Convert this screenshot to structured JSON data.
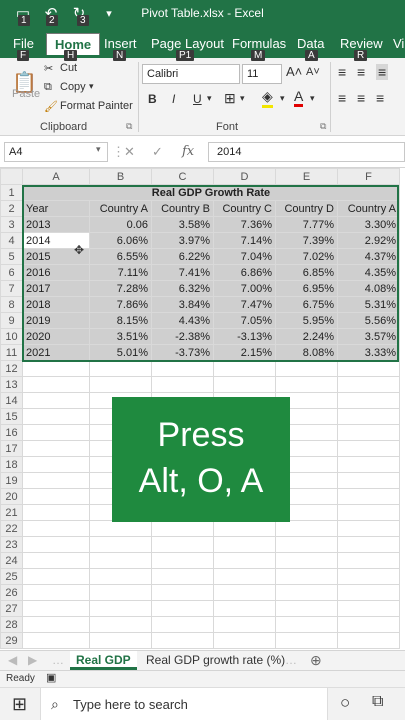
{
  "title_bar": {
    "title": "Pivot Table.xlsx - Excel",
    "keytips": [
      "1",
      "2",
      "3"
    ]
  },
  "ribbon_tabs": [
    {
      "label": "File",
      "keytip": "F"
    },
    {
      "label": "Home",
      "keytip": "H"
    },
    {
      "label": "Insert",
      "keytip": "N"
    },
    {
      "label": "Page Layout",
      "keytip": "P1"
    },
    {
      "label": "Formulas",
      "keytip": "M"
    },
    {
      "label": "Data",
      "keytip": "A"
    },
    {
      "label": "Review",
      "keytip": "R"
    },
    {
      "label": "Vi",
      "keytip": ""
    }
  ],
  "clipboard": {
    "paste": "Paste",
    "cut": "Cut",
    "copy": "Copy",
    "format_painter": "Format Painter",
    "label": "Clipboard"
  },
  "font": {
    "name": "Calibri",
    "size": "11",
    "bold": "B",
    "italic": "I",
    "underline": "U",
    "label": "Font"
  },
  "formula_bar": {
    "name_box": "A4",
    "fx": "fx",
    "value": "2014"
  },
  "columns": [
    "A",
    "B",
    "C",
    "D",
    "E",
    "F"
  ],
  "sheet": {
    "title": "Real GDP Growth Rate",
    "headers": [
      "Year",
      "Country A",
      "Country B",
      "Country C",
      "Country D",
      "Country A"
    ],
    "rows": [
      [
        "2013",
        "0.06",
        "3.58%",
        "7.36%",
        "7.77%",
        "3.30%"
      ],
      [
        "2014",
        "6.06%",
        "3.97%",
        "7.14%",
        "7.39%",
        "2.92%"
      ],
      [
        "2015",
        "6.55%",
        "6.22%",
        "7.04%",
        "7.02%",
        "4.37%"
      ],
      [
        "2016",
        "7.11%",
        "7.41%",
        "6.86%",
        "6.85%",
        "4.35%"
      ],
      [
        "2017",
        "7.28%",
        "6.32%",
        "7.00%",
        "6.95%",
        "4.08%"
      ],
      [
        "2018",
        "7.86%",
        "3.84%",
        "7.47%",
        "6.75%",
        "5.31%"
      ],
      [
        "2019",
        "8.15%",
        "4.43%",
        "7.05%",
        "5.95%",
        "5.56%"
      ],
      [
        "2020",
        "3.51%",
        "-2.38%",
        "-3.13%",
        "2.24%",
        "3.57%"
      ],
      [
        "2021",
        "5.01%",
        "-3.73%",
        "2.15%",
        "8.08%",
        "3.33%"
      ]
    ],
    "row_numbers": [
      "1",
      "2",
      "3",
      "4",
      "5",
      "6",
      "7",
      "8",
      "9",
      "10",
      "11",
      "12",
      "13",
      "14",
      "15",
      "16",
      "17",
      "18",
      "19",
      "20",
      "21",
      "22",
      "23",
      "24",
      "25",
      "26",
      "27",
      "28",
      "29"
    ]
  },
  "overlay": {
    "line1": "Press",
    "line2": "Alt, O, A"
  },
  "sheet_tabs": [
    "Real GDP",
    "Real GDP growth rate (%)"
  ],
  "status": {
    "ready": "Ready"
  },
  "taskbar": {
    "search_placeholder": "Type here to search"
  },
  "colors": {
    "accent": "#217346",
    "overlay": "#1f8a3f",
    "selection": "#cfcfcf"
  }
}
